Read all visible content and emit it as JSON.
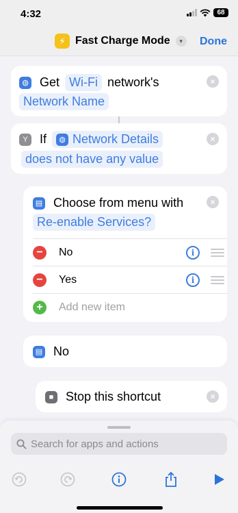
{
  "status_bar": {
    "time": "4:32",
    "battery": "68"
  },
  "nav": {
    "title": "Fast Charge Mode",
    "done_label": "Done",
    "icon": "bolt-icon"
  },
  "actions": {
    "get": {
      "verb": "Get",
      "param1": "Wi-Fi",
      "text2": "network's",
      "param2": "Network Name"
    },
    "if": {
      "verb": "If",
      "param1": "Network Details",
      "param2": "does not have any value"
    },
    "choose": {
      "text": "Choose from menu with",
      "param": "Re-enable Services?",
      "items": [
        "No",
        "Yes"
      ],
      "add_placeholder": "Add new item"
    },
    "menu_case": {
      "label": "No"
    },
    "stop": {
      "label": "Stop this shortcut"
    }
  },
  "search": {
    "placeholder": "Search for apps and actions"
  },
  "colors": {
    "accent": "#3f7de0",
    "bolt": "#f4c21b",
    "delete": "#e5453e",
    "add": "#55b949",
    "done": "#2b74d9"
  }
}
